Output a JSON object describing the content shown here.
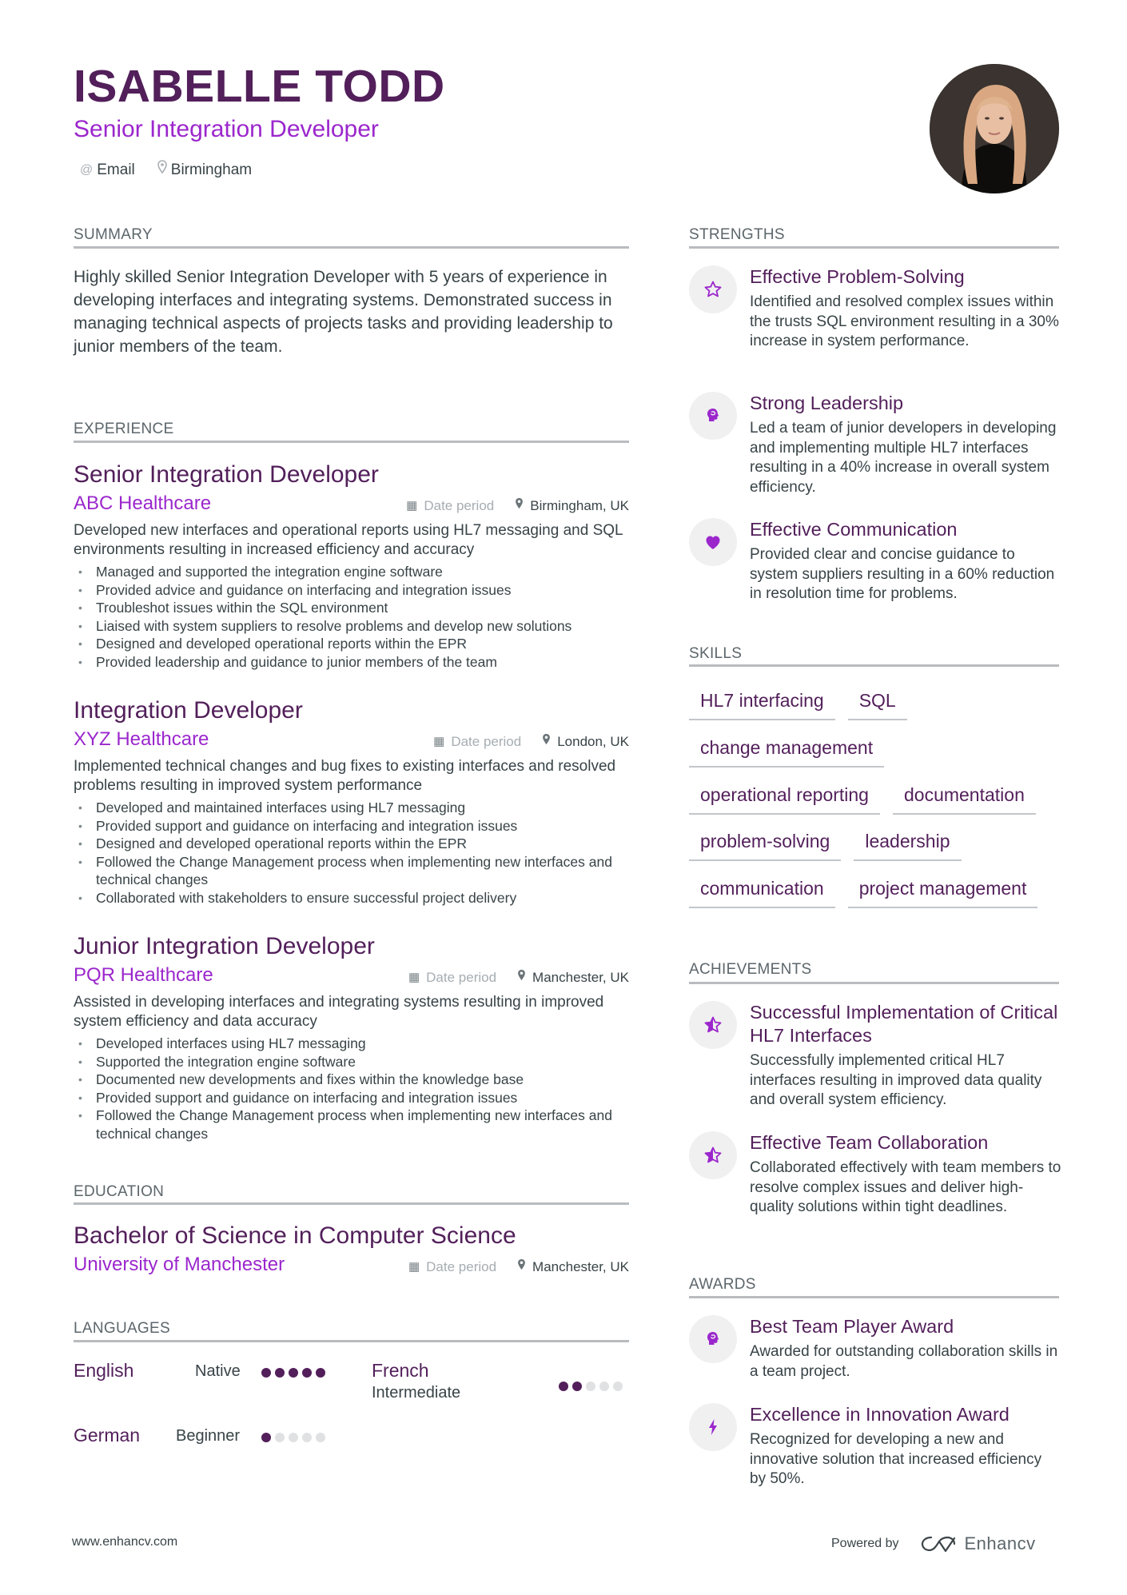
{
  "header": {
    "name": "ISABELLE TODD",
    "title": "Senior Integration Developer",
    "contacts": [
      {
        "icon": "at-icon",
        "label": "Email"
      },
      {
        "icon": "location-pin-icon",
        "label": "Birmingham"
      }
    ],
    "photo_alt": "Profile photo of Isabelle Todd"
  },
  "summary": {
    "heading": "SUMMARY",
    "text": "Highly skilled Senior Integration Developer with 5 years of experience in developing interfaces and integrating systems. Demonstrated success in managing technical aspects of projects tasks and providing leadership to junior members of the team."
  },
  "experience": {
    "heading": "EXPERIENCE",
    "jobs": [
      {
        "title": "Senior Integration Developer",
        "company": "ABC Healthcare",
        "date": "Date period",
        "location": "Birmingham, UK",
        "description": "Developed new interfaces and operational reports using HL7 messaging and SQL environments resulting in increased efficiency and accuracy",
        "bullets": [
          "Managed and supported the integration engine software",
          "Provided advice and guidance on interfacing and integration issues",
          "Troubleshot issues within the SQL environment",
          "Liaised with system suppliers to resolve problems and develop new solutions",
          "Designed and developed operational reports within the EPR",
          "Provided leadership and guidance to junior members of the team"
        ]
      },
      {
        "title": "Integration Developer",
        "company": "XYZ Healthcare",
        "date": "Date period",
        "location": "London, UK",
        "description": "Implemented technical changes and bug fixes to existing interfaces and resolved problems resulting in improved system performance",
        "bullets": [
          "Developed and maintained interfaces using HL7 messaging",
          "Provided support and guidance on interfacing and integration issues",
          "Designed and developed operational reports within the EPR",
          "Followed the Change Management process when implementing new interfaces and technical changes",
          "Collaborated with stakeholders to ensure successful project delivery"
        ]
      },
      {
        "title": "Junior Integration Developer",
        "company": "PQR Healthcare",
        "date": "Date period",
        "location": "Manchester, UK",
        "description": "Assisted in developing interfaces and integrating systems resulting in improved system efficiency and data accuracy",
        "bullets": [
          "Developed interfaces using HL7 messaging",
          "Supported the integration engine software",
          "Documented new developments and fixes within the knowledge base",
          "Provided support and guidance on interfacing and integration issues",
          "Followed the Change Management process when implementing new interfaces and technical changes"
        ]
      }
    ]
  },
  "education": {
    "heading": "EDUCATION",
    "degree": "Bachelor of Science in Computer Science",
    "school": "University of Manchester",
    "date": "Date period",
    "location": "Manchester, UK"
  },
  "languages": {
    "heading": "LANGUAGES",
    "items": [
      {
        "name": "English",
        "level": "Native",
        "rating": 5,
        "max": 5
      },
      {
        "name": "French",
        "level": "Intermediate",
        "rating": 2,
        "max": 5
      },
      {
        "name": "German",
        "level": "Beginner",
        "rating": 1,
        "max": 5
      }
    ]
  },
  "strengths": {
    "heading": "STRENGTHS",
    "items": [
      {
        "icon": "star-outline-icon",
        "title": "Effective Problem-Solving",
        "description": "Identified and resolved complex issues within the trusts SQL environment resulting in a 30% increase in system performance."
      },
      {
        "icon": "head-brain-icon",
        "title": "Strong Leadership",
        "description": "Led a team of junior developers in developing and implementing multiple HL7 interfaces resulting in a 40% increase in overall system efficiency."
      },
      {
        "icon": "heart-icon",
        "title": "Effective Communication",
        "description": "Provided clear and concise guidance to system suppliers resulting in a 60% reduction in resolution time for problems."
      }
    ]
  },
  "skills": {
    "heading": "SKILLS",
    "rows": [
      [
        "HL7 interfacing",
        "SQL"
      ],
      [
        "change management"
      ],
      [
        "operational reporting",
        "documentation"
      ],
      [
        "problem-solving",
        "leadership"
      ],
      [
        "communication",
        "project management"
      ]
    ]
  },
  "achievements": {
    "heading": "ACHIEVEMENTS",
    "items": [
      {
        "icon": "star-half-icon",
        "title": "Successful Implementation of Critical HL7 Interfaces",
        "description": "Successfully implemented critical HL7 interfaces resulting in improved data quality and overall system efficiency."
      },
      {
        "icon": "star-half-icon",
        "title": "Effective Team Collaboration",
        "description": "Collaborated effectively with team members to resolve complex issues and deliver high-quality solutions within tight deadlines."
      }
    ]
  },
  "awards": {
    "heading": "AWARDS",
    "items": [
      {
        "icon": "head-brain-icon",
        "title": "Best Team Player Award",
        "description": "Awarded for outstanding collaboration skills in a team project."
      },
      {
        "icon": "lightning-bolt-icon",
        "title": "Excellence in Innovation Award",
        "description": "Recognized for developing a new and innovative solution that increased efficiency by 50%."
      }
    ]
  },
  "footer": {
    "url": "www.enhancv.com",
    "powered_by": "Powered by",
    "brand": "Enhancv"
  },
  "colors": {
    "name": "#521f5a",
    "accent": "#9b27cc",
    "text": "#384347",
    "heading": "#5c666b",
    "rule": "#b9bcbf",
    "icon_bg": "#f0f0f1",
    "dot_off": "#e0e1e3"
  }
}
